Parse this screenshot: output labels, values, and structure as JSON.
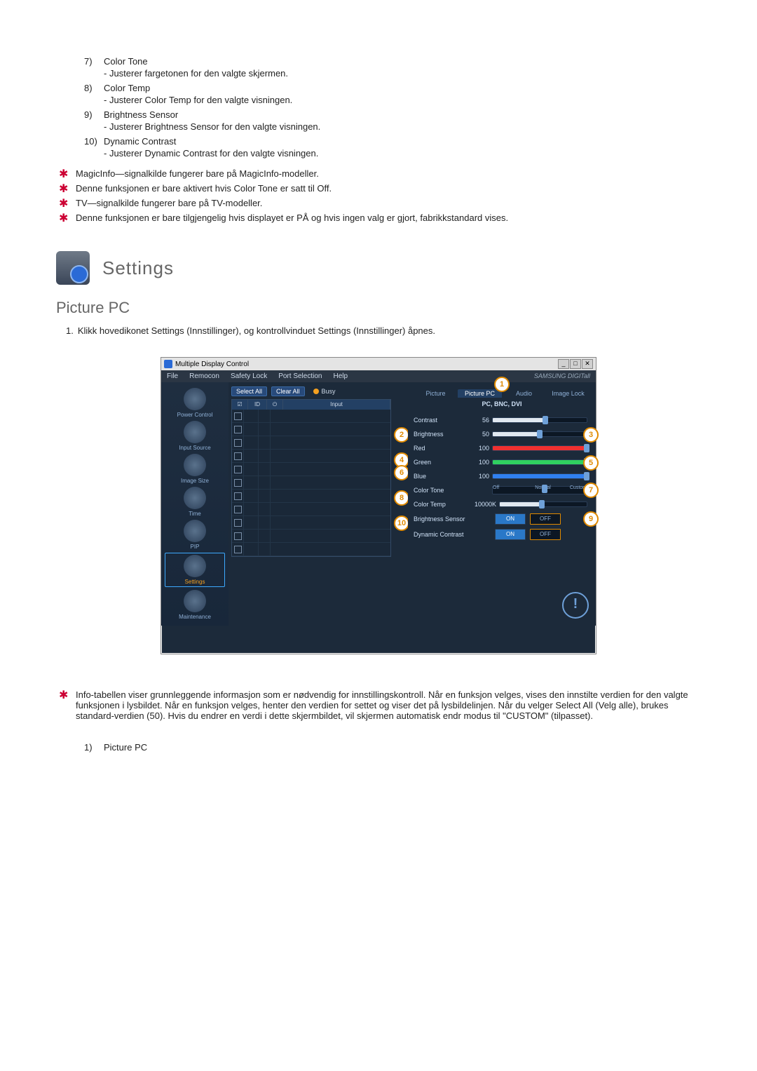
{
  "numbered": [
    {
      "n": "7)",
      "title": "Color Tone",
      "desc": "- Justerer fargetonen for den valgte skjermen."
    },
    {
      "n": "8)",
      "title": "Color Temp",
      "desc": "- Justerer Color Temp for den valgte visningen."
    },
    {
      "n": "9)",
      "title": "Brightness Sensor",
      "desc": "- Justerer Brightness Sensor for den valgte visningen."
    },
    {
      "n": "10)",
      "title": "Dynamic Contrast",
      "desc": "- Justerer Dynamic Contrast for den valgte visningen."
    }
  ],
  "notes_top": [
    "MagicInfo—signalkilde fungerer bare på MagicInfo-modeller.",
    "Denne funksjonen er bare aktivert hvis Color Tone er satt til Off.",
    "TV—signalkilde fungerer bare på TV-modeller.",
    "Denne funksjonen er bare tilgjengelig hvis displayet er PÅ og hvis ingen valg er gjort, fabrikkstandard vises."
  ],
  "section": {
    "title": "Settings",
    "sub": "Picture PC"
  },
  "step": {
    "n": "1.",
    "text": "Klikk hovedikonet Settings (Innstillinger), og kontrollvinduet Settings (Innstillinger) åpnes."
  },
  "win": {
    "title": "Multiple Display Control",
    "menus": [
      "File",
      "Remocon",
      "Safety Lock",
      "Port Selection",
      "Help"
    ],
    "brand": "SAMSUNG DIGITall"
  },
  "nav": {
    "items": [
      {
        "label": "Power Control"
      },
      {
        "label": "Input Source"
      },
      {
        "label": "Image Size"
      },
      {
        "label": "Time"
      },
      {
        "label": "PIP"
      },
      {
        "label": "Settings",
        "active": true
      },
      {
        "label": "Maintenance"
      }
    ]
  },
  "center": {
    "select_all": "Select All",
    "clear_all": "Clear All",
    "busy": "Busy",
    "head": {
      "chk": "☑",
      "id": "ID",
      "pw": "⏻",
      "input": "Input"
    },
    "row_count": 11,
    "callouts": {
      "2": 2,
      "4": 4,
      "6": 5,
      "8": 7,
      "10": 9
    },
    "callout_labels": {
      "c2": "2",
      "c4": "4",
      "c6": "6",
      "c8": "8",
      "c10": "10"
    }
  },
  "panel": {
    "tabs": [
      "Picture",
      "Picture PC",
      "Audio",
      "Image Lock"
    ],
    "active_tab": 1,
    "sub": "PC, BNC, DVI",
    "top_callout": "1",
    "rows": {
      "contrast": {
        "lbl": "Contrast",
        "val": "56",
        "pct": 56,
        "cls": "fill-white"
      },
      "brightness": {
        "lbl": "Brightness",
        "val": "50",
        "pct": 50,
        "cls": "fill-white"
      },
      "red": {
        "lbl": "Red",
        "val": "100",
        "pct": 100,
        "cls": "fill-red"
      },
      "green": {
        "lbl": "Green",
        "val": "100",
        "pct": 100,
        "cls": "fill-green"
      },
      "blue": {
        "lbl": "Blue",
        "val": "100",
        "pct": 100,
        "cls": "fill-blue"
      },
      "tone": {
        "lbl": "Color Tone",
        "labels": [
          "Off",
          "Normal",
          "Custom"
        ],
        "knob": 55
      },
      "temp": {
        "lbl": "Color Temp",
        "val": "10000K",
        "pct": 48
      },
      "bs": {
        "lbl": "Brightness Sensor",
        "on": "ON",
        "off": "OFF"
      },
      "dc": {
        "lbl": "Dynamic Contrast",
        "on": "ON",
        "off": "OFF"
      }
    },
    "right_callouts": {
      "r3": "3",
      "r5": "5",
      "r7": "7",
      "r9": "9"
    }
  },
  "notes_bottom": [
    "Info-tabellen viser grunnleggende informasjon som er nødvendig for innstillingskontroll. Når en funksjon velges, vises den innstilte verdien for den valgte funksjonen i lysbildet. Når en funksjon velges, henter den verdien for settet og viser det på lysbildelinjen. Når du velger Select All (Velg alle), brukes standard-verdien (50). Hvis du endrer en verdi i dette skjermbildet, vil skjermen automatisk endr modus til \"CUSTOM\" (tilpasset)."
  ],
  "final": {
    "n": "1)",
    "title": "Picture PC"
  }
}
